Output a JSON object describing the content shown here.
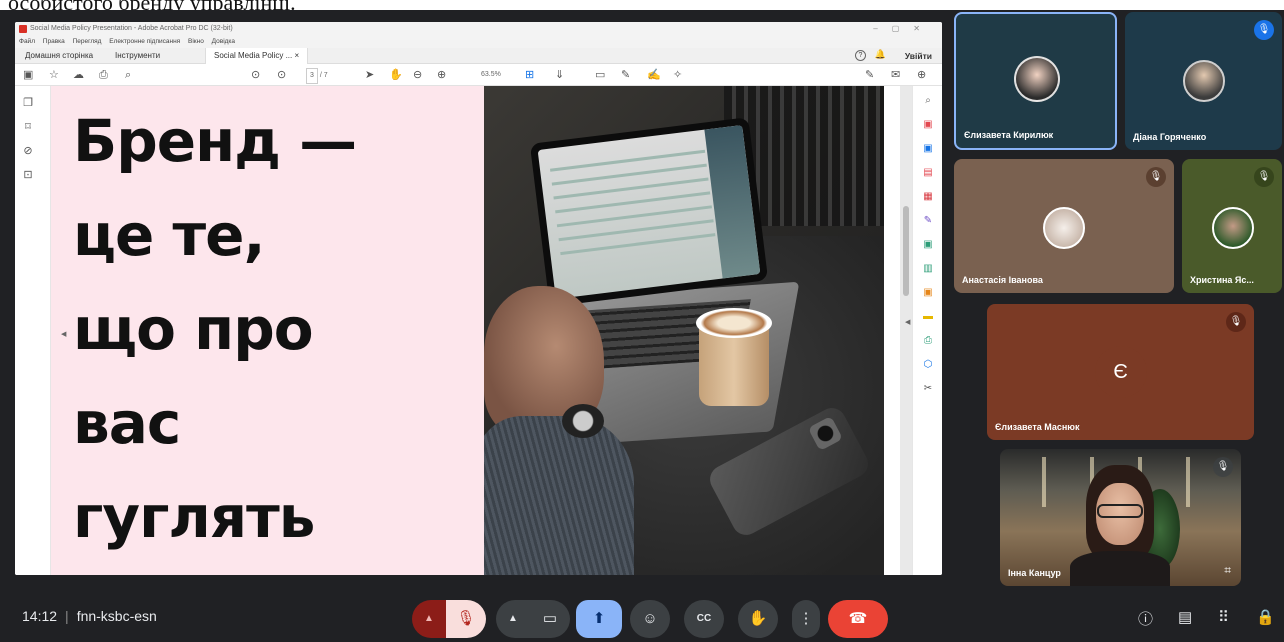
{
  "caption": {
    "text": "особистого бренду управлінці."
  },
  "acrobat": {
    "title": "Social Media Policy Presentation - Adobe Acrobat Pro DC (32-bit)",
    "menu": [
      "Файл",
      "Правка",
      "Перегляд",
      "Електронне підписання",
      "Вікно",
      "Довідка"
    ],
    "tabs": {
      "home": "Домашня сторінка",
      "tools": "Інструменти",
      "doc": "Social Media Policy ... ×"
    },
    "signin": "Увійти",
    "page_current": "3",
    "page_total": "/ 7",
    "zoom": "63.5%"
  },
  "slide": {
    "text": "Бренд —\nце те,\nщо про\nвас\nгуглять"
  },
  "participants": [
    {
      "name": "Єлизавета Кирилюк",
      "muted": false,
      "active": true
    },
    {
      "name": "Діана Горяченко",
      "muted": true
    },
    {
      "name": "Анастасія Іванова",
      "muted": true
    },
    {
      "name": "Христина Яс...",
      "muted": true
    },
    {
      "name": "Єлизавета Маснюк",
      "muted": true,
      "initial": "Є"
    },
    {
      "name": "Інна Канцур",
      "muted": true,
      "video": true
    }
  ],
  "meeting": {
    "time": "14:12",
    "code": "fnn-ksbc-esn"
  },
  "icons": {
    "chevron_up": "▲",
    "mic_off": "🎙",
    "camera": "▭",
    "present": "⬆",
    "emoji": "☺",
    "captions": "CC",
    "hand": "✋",
    "more": "⋮",
    "hangup": "☎",
    "info": "ⓘ",
    "chat": "▤",
    "activities": "⠿",
    "host": "🔒"
  },
  "colors": {
    "tile_liza": "#1f3a46",
    "tile_diana": "#1e3a4a",
    "tile_anastasia": "#7a6150",
    "tile_khrystyna": "#4a5a2a",
    "tile_maсniuk": "#7b3a25",
    "accent_active": "#8ab4f8",
    "hangup": "#ea4335"
  }
}
